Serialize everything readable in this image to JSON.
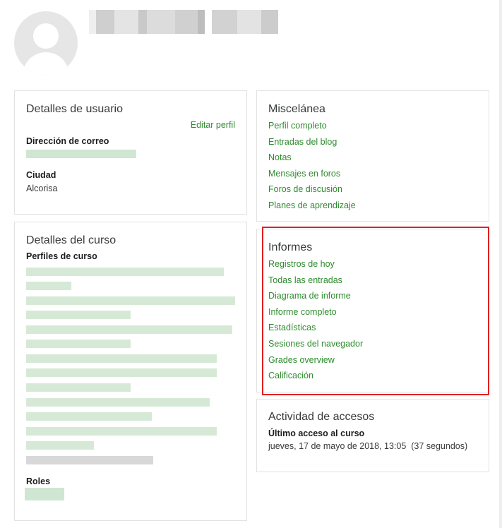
{
  "details_user": {
    "title": "Detalles de usuario",
    "edit_label": "Editar perfil",
    "email_label": "Dirección de correo",
    "city_label": "Ciudad",
    "city_value": "Alcorisa"
  },
  "course_details": {
    "title": "Detalles del curso",
    "profiles_label": "Perfiles de curso",
    "roles_label": "Roles"
  },
  "misc": {
    "title": "Miscelánea",
    "links": [
      "Perfil completo",
      "Entradas del blog",
      "Notas",
      "Mensajes en foros",
      "Foros de discusión",
      "Planes de aprendizaje"
    ]
  },
  "reports": {
    "title": "Informes",
    "links": [
      "Registros de hoy",
      "Todas las entradas",
      "Diagrama de informe",
      "Informe completo",
      "Estadísticas",
      "Sesiones del navegador",
      "Grades overview",
      "Calificación"
    ]
  },
  "access": {
    "title": "Actividad de accesos",
    "last_access_label": "Último acceso al curso",
    "last_access_value": "jueves, 17 de mayo de 2018, 13:05  (37 segundos)"
  },
  "colors": {
    "link": "#2e8b2e",
    "highlight": "#e02020"
  }
}
